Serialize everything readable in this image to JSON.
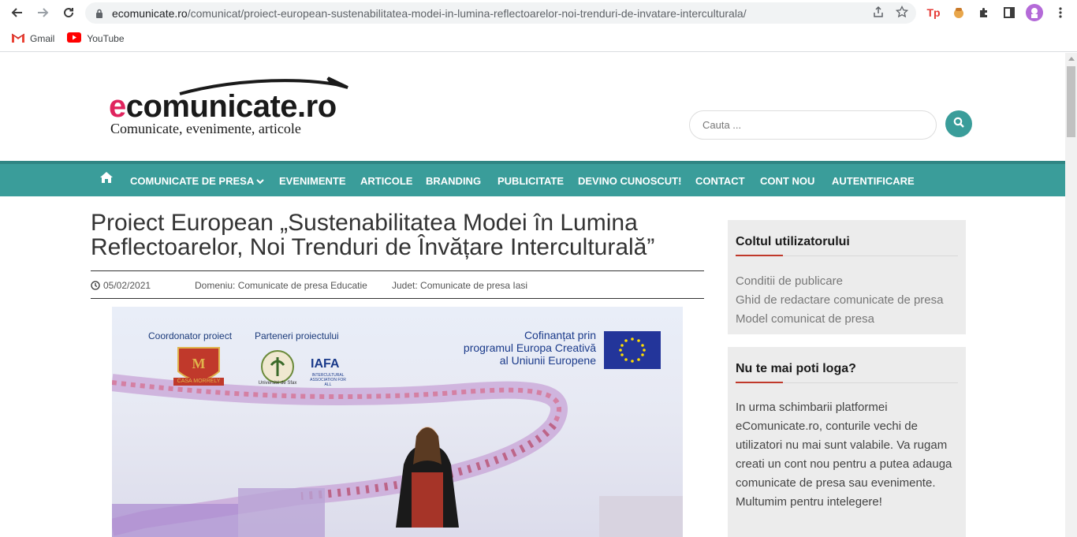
{
  "browser": {
    "url_host": "ecomunicate.ro",
    "url_path": "/comunicat/proiect-european-sustenabilitatea-modei-in-lumina-reflectoarelor-noi-trenduri-de-invatare-interculturala/",
    "bookmarks": [
      {
        "label": "Gmail",
        "icon": "gmail-icon"
      },
      {
        "label": "YouTube",
        "icon": "youtube-icon"
      }
    ]
  },
  "site": {
    "logo_main": "comunicate.ro",
    "logo_e": "e",
    "tagline": "Comunicate, evenimente, articole",
    "search_placeholder": "Cauta ..."
  },
  "nav": {
    "items": [
      "COMUNICATE DE PRESA",
      "EVENIMENTE",
      "ARTICOLE",
      "BRANDING",
      "PUBLICITATE",
      "DEVINO CUNOSCUT!",
      "CONTACT",
      "CONT NOU",
      "AUTENTIFICARE"
    ]
  },
  "article": {
    "title": "Proiect European „Sustenabilitatea Modei în Lumina Reflectoarelor, Noi Trenduri de Învățare Interculturală”",
    "date": "05/02/2021",
    "domeniu": "Domeniu: Comunicate de presa Educatie",
    "judet": "Judet: Comunicate de presa Iasi"
  },
  "featured_image": {
    "coordonator": "Coordonator proiect",
    "parteneri": "Parteneri proiectului",
    "cofinantat_line1": "Cofinanțat prin",
    "cofinantat_line2": "programul Europa Creativă",
    "cofinantat_line3": "al Uniunii Europene",
    "coord_logo_text": "CASA MORRELY",
    "univ_text": "Université de Sfax",
    "iafa_text": "IAFA",
    "iafa_sub": "INTERCULTURAL ASSOCIATION FOR ALL"
  },
  "sidebar": {
    "widget1_title": "Coltul utilizatorului",
    "widget1_links": [
      "Conditii de publicare",
      "Ghid de redactare comunicate de presa",
      "Model comunicat de presa"
    ],
    "widget2_title": "Nu te mai poti loga?",
    "widget2_text": "In urma schimbarii platformei eComunicate.ro, conturile vechi de utilizatori nu mai sunt valabile. Va rugam creati un cont nou pentru a putea adauga comunicate de presa sau evenimente. Multumim pentru intelegere!"
  },
  "colors": {
    "nav_bg": "#3a9d9a",
    "accent_red": "#c0392b",
    "logo_pink": "#e0245e"
  }
}
